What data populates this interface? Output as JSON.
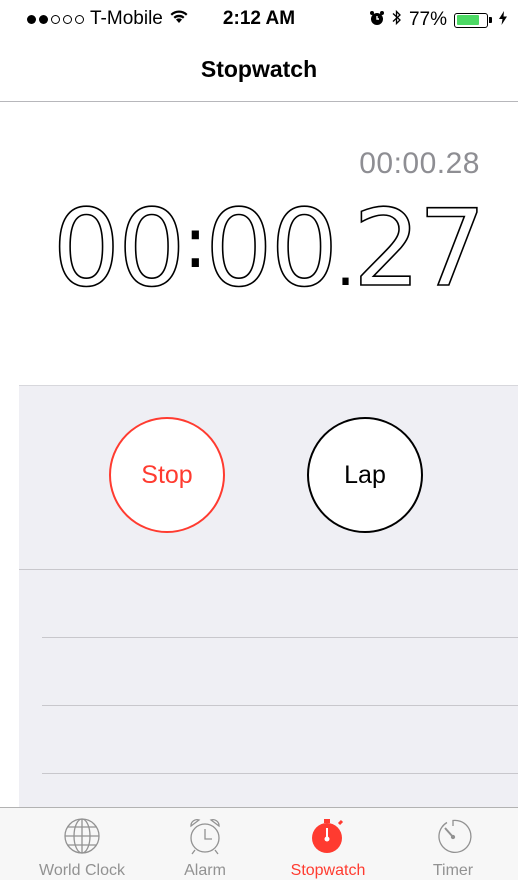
{
  "status_bar": {
    "carrier": "T-Mobile",
    "signal_bars_filled": 2,
    "signal_bars_total": 5,
    "time": "2:12 AM",
    "battery_percent": "77%",
    "battery_level": 0.77,
    "icons": [
      "wifi-icon",
      "alarm-clock-icon",
      "bluetooth-icon",
      "battery-icon",
      "charging-bolt-icon"
    ]
  },
  "nav": {
    "title": "Stopwatch"
  },
  "stopwatch": {
    "lap_time": "00:00.28",
    "main_time": {
      "minutes": "00",
      "seconds": "00",
      "hundredths": "27"
    }
  },
  "controls": {
    "stop_label": "Stop",
    "lap_label": "Lap"
  },
  "tabs": [
    {
      "label": "World Clock",
      "icon": "globe-icon",
      "active": false
    },
    {
      "label": "Alarm",
      "icon": "alarm-clock-icon",
      "active": false
    },
    {
      "label": "Stopwatch",
      "icon": "stopwatch-icon",
      "active": true
    },
    {
      "label": "Timer",
      "icon": "timer-icon",
      "active": false
    }
  ],
  "colors": {
    "accent": "#ff3b30",
    "battery": "#4cd964",
    "inactive": "#929292",
    "panel": "#efeff4"
  }
}
